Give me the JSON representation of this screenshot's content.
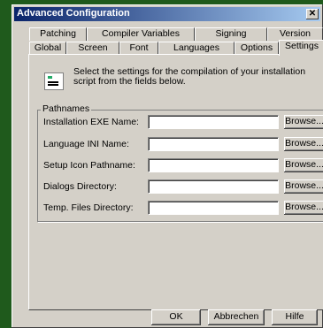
{
  "window": {
    "title": "Advanced Configuration"
  },
  "tabs": {
    "back": [
      "Patching",
      "Compiler Variables",
      "Signing",
      "Version"
    ],
    "front": [
      "Global",
      "Screen",
      "Font",
      "Languages",
      "Options",
      "Settings"
    ],
    "selected": "Settings"
  },
  "settings": {
    "description": "Select the settings for the compilation of your installation script from the fields below.",
    "group_label": "Pathnames",
    "fields": [
      {
        "label": "Installation EXE Name:",
        "value": "",
        "button": "Browse..."
      },
      {
        "label": "Language INI Name:",
        "value": "",
        "button": "Browse..."
      },
      {
        "label": "Setup Icon Pathname:",
        "value": "",
        "button": "Browse..."
      },
      {
        "label": "Dialogs Directory:",
        "value": "",
        "button": "Browse..."
      },
      {
        "label": "Temp. Files Directory:",
        "value": "",
        "button": "Browse..."
      }
    ]
  },
  "buttons": {
    "ok": "OK",
    "cancel": "Abbrechen",
    "help": "Hilfe"
  }
}
